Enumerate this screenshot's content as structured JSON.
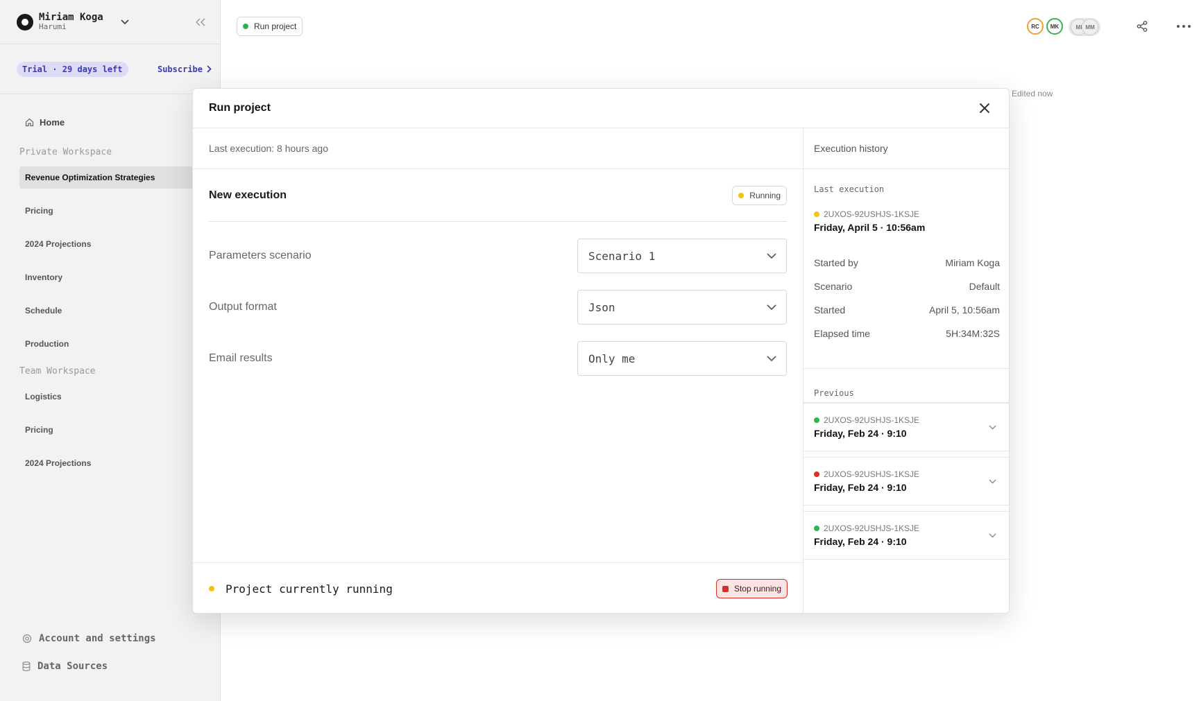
{
  "user": {
    "name": "Miriam Koga",
    "subtitle": "Harumi"
  },
  "trial": {
    "badge": "Trial · 29 days left",
    "subscribe_label": "Subscribe"
  },
  "nav": {
    "home_label": "Home",
    "private_section": "Private Workspace",
    "private_items": [
      {
        "label": "Revenue Optimization Strategies",
        "active": true
      },
      {
        "label": "Pricing"
      },
      {
        "label": "2024 Projections"
      },
      {
        "label": "Inventory"
      },
      {
        "label": "Schedule"
      },
      {
        "label": "Production"
      }
    ],
    "team_section": "Team Workspace",
    "team_items": [
      {
        "label": "Logistics"
      },
      {
        "label": "Pricing"
      },
      {
        "label": "2024 Projections"
      }
    ],
    "bottom": {
      "settings_label": "Account and settings",
      "data_sources_label": "Data Sources"
    }
  },
  "topbar": {
    "run_chip_label": "Run project",
    "avatars": [
      "RC",
      "MK",
      "MI",
      "MM"
    ],
    "edited_label": "Edited now"
  },
  "modal": {
    "title": "Run project",
    "last_execution_text": "Last execution: 8 hours ago",
    "new_execution_title": "New execution",
    "running_badge": "Running",
    "fields": [
      {
        "label": "Parameters scenario",
        "value": "Scenario 1"
      },
      {
        "label": "Output format",
        "value": "Json"
      },
      {
        "label": "Email results",
        "value": "Only me"
      }
    ],
    "footer_status": "Project currently running",
    "stop_button": "Stop running"
  },
  "history": {
    "title": "Execution history",
    "last_label": "Last execution",
    "last": {
      "id": "2UXOS-92USHJS-1KSJE",
      "date": "Friday, April 5 · 10:56am",
      "status": "running",
      "details": [
        {
          "key": "Started by",
          "value": "Miriam Koga"
        },
        {
          "key": "Scenario",
          "value": "Default"
        },
        {
          "key": "Started",
          "value": "April 5, 10:56am"
        },
        {
          "key": "Elapsed time",
          "value": "5H:34M:32S"
        }
      ]
    },
    "previous_label": "Previous",
    "previous": [
      {
        "id": "2UXOS-92USHJS-1KSJE",
        "date": "Friday, Feb 24 · 9:10",
        "status": "success"
      },
      {
        "id": "2UXOS-92USHJS-1KSJE",
        "date": "Friday, Feb 24 · 9:10",
        "status": "failed"
      },
      {
        "id": "2UXOS-92USHJS-1KSJE",
        "date": "Friday, Feb 24 · 9:10",
        "status": "success"
      }
    ]
  },
  "colors": {
    "accent": "#3a39b8",
    "success": "#2fb34a",
    "running": "#f1c40f",
    "error": "#d93025"
  }
}
